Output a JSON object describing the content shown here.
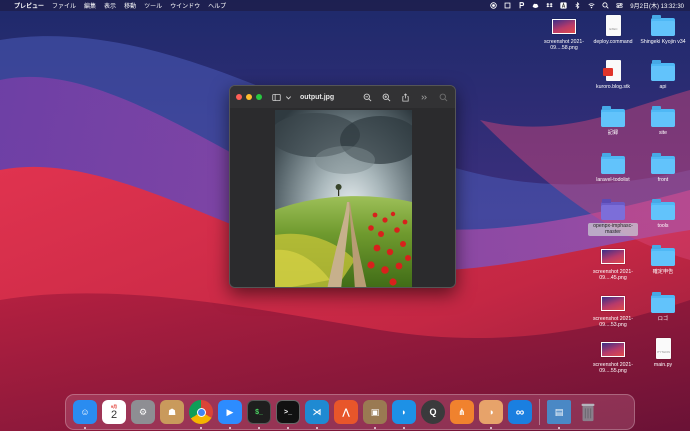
{
  "menubar": {
    "app_name": "プレビュー",
    "menus": [
      "ファイル",
      "編集",
      "表示",
      "移動",
      "ツール",
      "ウインドウ",
      "ヘルプ"
    ],
    "clock": "9月2日(木) 13:32:30",
    "status_icons": [
      "record-icon",
      "box-icon",
      "p-icon",
      "cloud-icon",
      "dropbox-icon",
      "a-icon",
      "bluetooth-icon",
      "wifi-icon",
      "search-icon",
      "control-center-icon"
    ]
  },
  "window": {
    "title": "output.jpg"
  },
  "desktop_icons": [
    {
      "label": "screenshot 2021-09....58.png",
      "kind": "screenshot"
    },
    {
      "label": "deploy.command",
      "kind": "document",
      "tag": "EXEC"
    },
    {
      "label": "Shingeki Kyojin v34",
      "kind": "folder"
    },
    {
      "label": "kuroro.blog.stk",
      "kind": "pdf"
    },
    {
      "label": "api",
      "kind": "folder"
    },
    {
      "label": "記録",
      "kind": "folder"
    },
    {
      "label": "site",
      "kind": "folder"
    },
    {
      "label": "laravel-todolist",
      "kind": "folder"
    },
    {
      "label": "front",
      "kind": "folder"
    },
    {
      "label": "openpx-imphasc-master",
      "kind": "folder-selected"
    },
    {
      "label": "tools",
      "kind": "folder"
    },
    {
      "label": "screenshot 2021-09....45.png",
      "kind": "screenshot"
    },
    {
      "label": "確定申告",
      "kind": "folder"
    },
    {
      "label": "screenshot 2021-09....53.png",
      "kind": "screenshot"
    },
    {
      "label": "ロゴ",
      "kind": "folder"
    },
    {
      "label": "screenshot 2021-09....55.png",
      "kind": "screenshot"
    },
    {
      "label": "main.py",
      "kind": "document",
      "tag": "PYTHON"
    }
  ],
  "calendar": {
    "month": "9月",
    "day": "2"
  },
  "dock_apps": [
    {
      "name": "finder",
      "color": "#2a8cf0",
      "glyph": "☺"
    },
    {
      "name": "calendar",
      "color": "#ffffff",
      "glyph": ""
    },
    {
      "name": "system-preferences",
      "color": "#8e8e93",
      "glyph": "⚙"
    },
    {
      "name": "contacts",
      "color": "#c99a5c",
      "glyph": "☗"
    },
    {
      "name": "chrome",
      "color": "#ffffff",
      "glyph": "◉"
    },
    {
      "name": "zoom",
      "color": "#2d8cff",
      "glyph": "▶"
    },
    {
      "name": "terminal",
      "color": "#1e1e1e",
      "glyph": "$_"
    },
    {
      "name": "iterm",
      "color": "#111111",
      "glyph": ">_"
    },
    {
      "name": "vscode",
      "color": "#1f8ad2",
      "glyph": "⋊"
    },
    {
      "name": "activity-monitor",
      "color": "#e8562a",
      "glyph": "⋀"
    },
    {
      "name": "archive-utility",
      "color": "#9a7a52",
      "glyph": "▣"
    },
    {
      "name": "docker",
      "color": "#1d91e6",
      "glyph": "◗"
    },
    {
      "name": "quicktime",
      "color": "#3a3a3c",
      "glyph": "Q"
    },
    {
      "name": "sourcetree",
      "color": "#f0822e",
      "glyph": "⋔"
    },
    {
      "name": "preview",
      "color": "#e7a36a",
      "glyph": "◑"
    },
    {
      "name": "infinity",
      "color": "#1a7fe0",
      "glyph": "∞"
    },
    {
      "name": "downloads-stack",
      "color": "#4a88c5",
      "glyph": "▤"
    },
    {
      "name": "trash",
      "color": "#7f7f86",
      "glyph": "▥"
    }
  ]
}
